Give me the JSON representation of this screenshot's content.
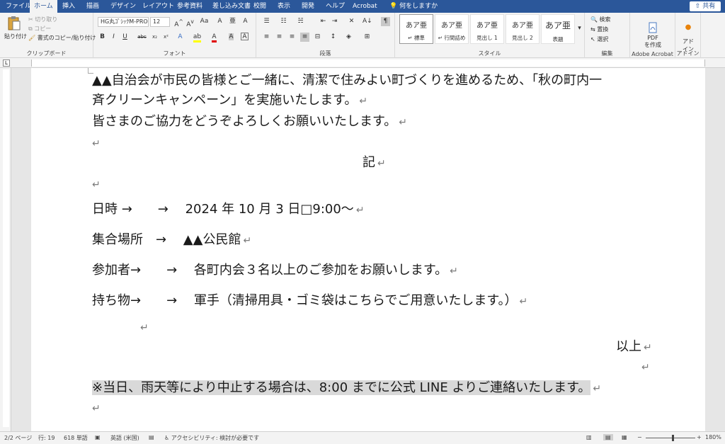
{
  "tabs": [
    "ファイル",
    "ホーム",
    "挿入",
    "描画",
    "デザイン",
    "レイアウト",
    "参考資料",
    "差し込み文書",
    "校閲",
    "表示",
    "開発",
    "ヘルプ",
    "Acrobat",
    "何をしますか"
  ],
  "share_label": "共有",
  "ribbon": {
    "clipboard": {
      "paste": "貼り付け",
      "cut": "切り取り",
      "copy": "コピー",
      "format_painter": "書式のコピー/貼り付け",
      "label": "クリップボード"
    },
    "font": {
      "name": "HG丸ｺﾞｼｯｸM-PRO",
      "size": "12",
      "label": "フォント"
    },
    "paragraph": {
      "label": "段落"
    },
    "styles": {
      "label": "スタイル",
      "items": [
        {
          "sample": "あア亜",
          "name": "標準"
        },
        {
          "sample": "あア亜",
          "name": "行間詰め"
        },
        {
          "sample": "あア亜",
          "name": "見出し 1"
        },
        {
          "sample": "あア亜",
          "name": "見出し 2"
        },
        {
          "sample": "あア亜",
          "name": "表題"
        }
      ]
    },
    "editing": {
      "search": "検索",
      "replace": "置換",
      "select": "選択",
      "label": "編集"
    },
    "acrobat": {
      "button": "PDF\nを作成",
      "label": "Adobe Acrobat"
    },
    "addin": {
      "button": "アド\nイン",
      "label": "アドイン"
    }
  },
  "document": {
    "lines": [
      "▲▲自治会が市民の皆様とご一緒に、清潔で住みよい町づくりを進めるため、「秋の町内一",
      "斉クリーンキャンペーン」を実施いたします。",
      "皆さまのご協力をどうぞよろしくお願いいたします。",
      "",
      "記",
      "",
      "日時 →　　→　 2024 年 10 月 3 日□9:00～",
      "集合場所　→　 ▲▲公民館",
      "参加者→　　→　 各町内会３名以上のご参加をお願いします。",
      "持ち物→　　→　 軍手（清掃用具・ゴミ袋はこちらでご用意いたします。）",
      "",
      "以上",
      "",
      "※当日、雨天等により中止する場合は、8:00 までに公式 LINE よりご連絡いたします。",
      ""
    ],
    "paragraph_mark": "↵"
  },
  "status": {
    "page": "2/2 ページ",
    "line": "行: 19",
    "words": "618 単語",
    "language": "英語 (米国)",
    "accessibility": "アクセシビリティ: 検討が必要です",
    "zoom": "180%"
  }
}
